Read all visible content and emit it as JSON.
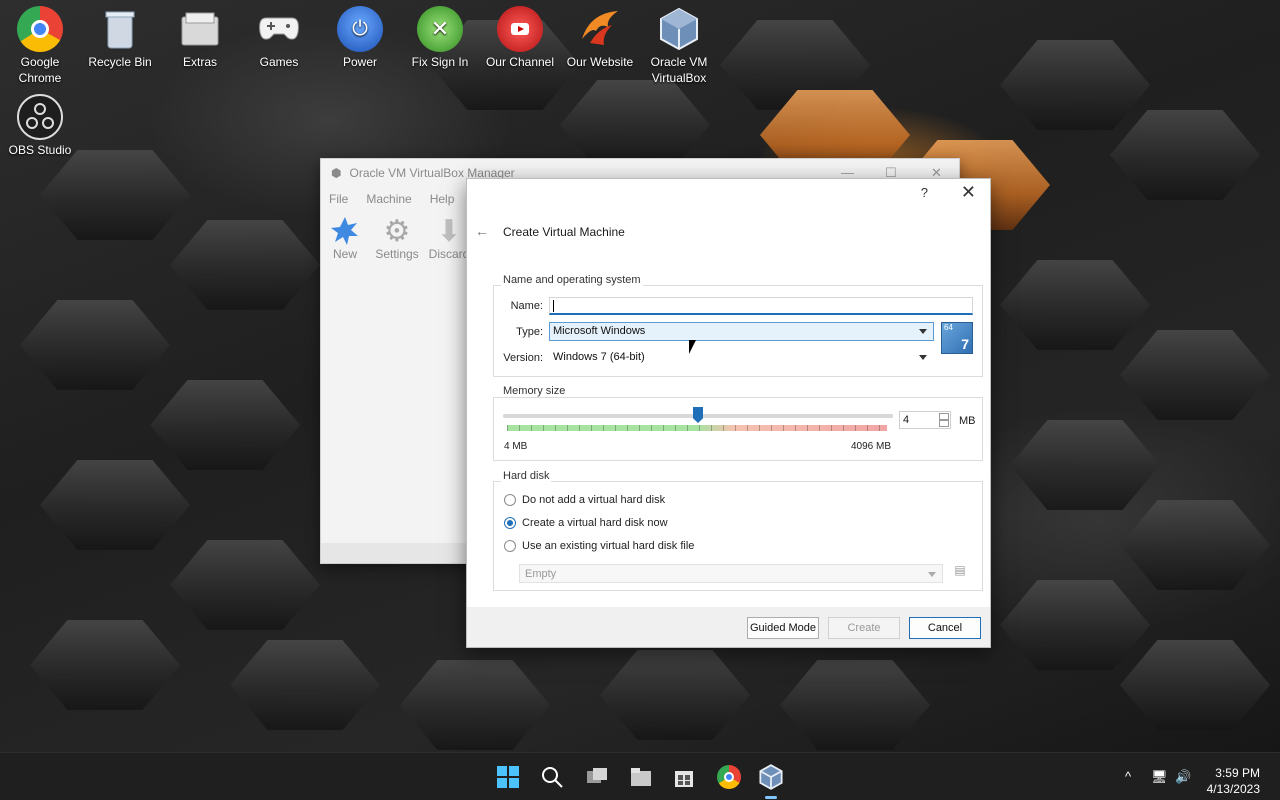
{
  "desktop": {
    "icons": [
      {
        "label": "Google\nChrome",
        "icon": "chrome-icon"
      },
      {
        "label": "Recycle Bin",
        "icon": "recycle-bin-icon"
      },
      {
        "label": "Extras",
        "icon": "folder-icon"
      },
      {
        "label": "Games",
        "icon": "gamepad-icon"
      },
      {
        "label": "Power",
        "icon": "power-icon"
      },
      {
        "label": "Fix Sign In",
        "icon": "xbox-icon"
      },
      {
        "label": "Our Channel",
        "icon": "youtube-icon"
      },
      {
        "label": "Our Website",
        "icon": "phoenix-icon"
      },
      {
        "label": "Oracle VM\nVirtualBox",
        "icon": "virtualbox-icon"
      },
      {
        "label": "OBS Studio",
        "icon": "obs-icon"
      }
    ]
  },
  "manager": {
    "title": "Oracle VM VirtualBox Manager",
    "menu": [
      "File",
      "Machine",
      "Help"
    ],
    "toolbar": [
      "New",
      "Settings",
      "Discard"
    ]
  },
  "dialog": {
    "help_glyph": "?",
    "close_glyph": "✕",
    "back_glyph": "←",
    "heading": "Create Virtual Machine",
    "name_section": {
      "title": "Name and operating system",
      "name_label": "Name:",
      "name_value": "",
      "type_label": "Type:",
      "type_value": "Microsoft Windows",
      "version_label": "Version:",
      "version_value": "Windows 7 (64-bit)",
      "os_badge_top": "64",
      "os_badge_num": "7"
    },
    "memory_section": {
      "title": "Memory size",
      "min": "4 MB",
      "max": "4096 MB",
      "value": "4",
      "unit": "MB",
      "slider_fraction": 0.5
    },
    "disk_section": {
      "title": "Hard disk",
      "options": [
        "Do not add a virtual hard disk",
        "Create a virtual hard disk now",
        "Use an existing virtual hard disk file"
      ],
      "selected_index": 1,
      "file_value": "Empty"
    },
    "buttons": {
      "guided": "Guided Mode",
      "create": "Create",
      "cancel": "Cancel"
    }
  },
  "taskbar": {
    "apps": [
      "start-icon",
      "search-icon",
      "task-view-icon",
      "file-explorer-icon",
      "store-icon",
      "chrome-icon",
      "virtualbox-icon"
    ],
    "tray_chevron": "^",
    "time": "3:59 PM",
    "date": "4/13/2023"
  }
}
